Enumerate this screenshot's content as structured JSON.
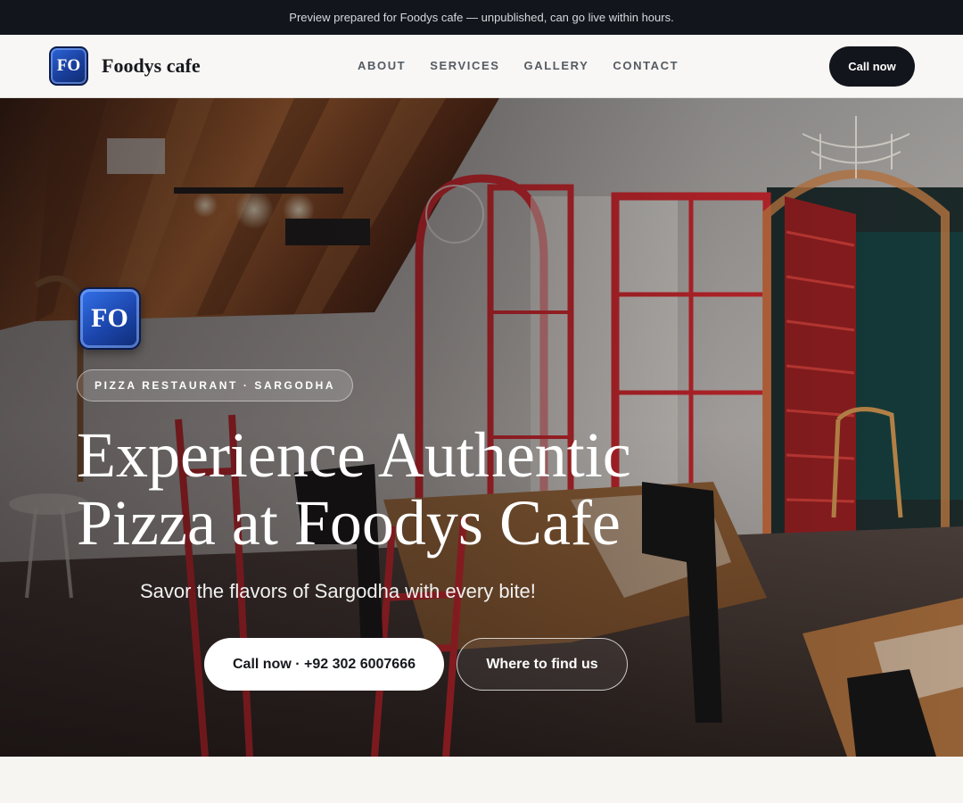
{
  "banner": {
    "text": "Preview prepared for Foodys cafe — unpublished, can go live within hours."
  },
  "brand": {
    "logo_initials": "FO",
    "name": "Foodys cafe"
  },
  "nav": {
    "links": [
      {
        "label": "ABOUT"
      },
      {
        "label": "SERVICES"
      },
      {
        "label": "GALLERY"
      },
      {
        "label": "CONTACT"
      }
    ],
    "cta_label": "Call now"
  },
  "hero": {
    "logo_initials": "FO",
    "tagline": "PIZZA RESTAURANT · SARGODHA",
    "title_line1": "Experience Authentic",
    "title_line2": "Pizza at Foodys Cafe",
    "subtitle": "Savor the flavors of Sargodha with every bite!",
    "primary_button": "Call now · +92 302 6007666",
    "secondary_button": "Where to find us",
    "background_image": "restaurant-interior-photo"
  },
  "colors": {
    "dark": "#12151b",
    "logo_blue": "#1c46ad",
    "accent_red": "#c4252b",
    "page_bg": "#f7f5f1"
  }
}
